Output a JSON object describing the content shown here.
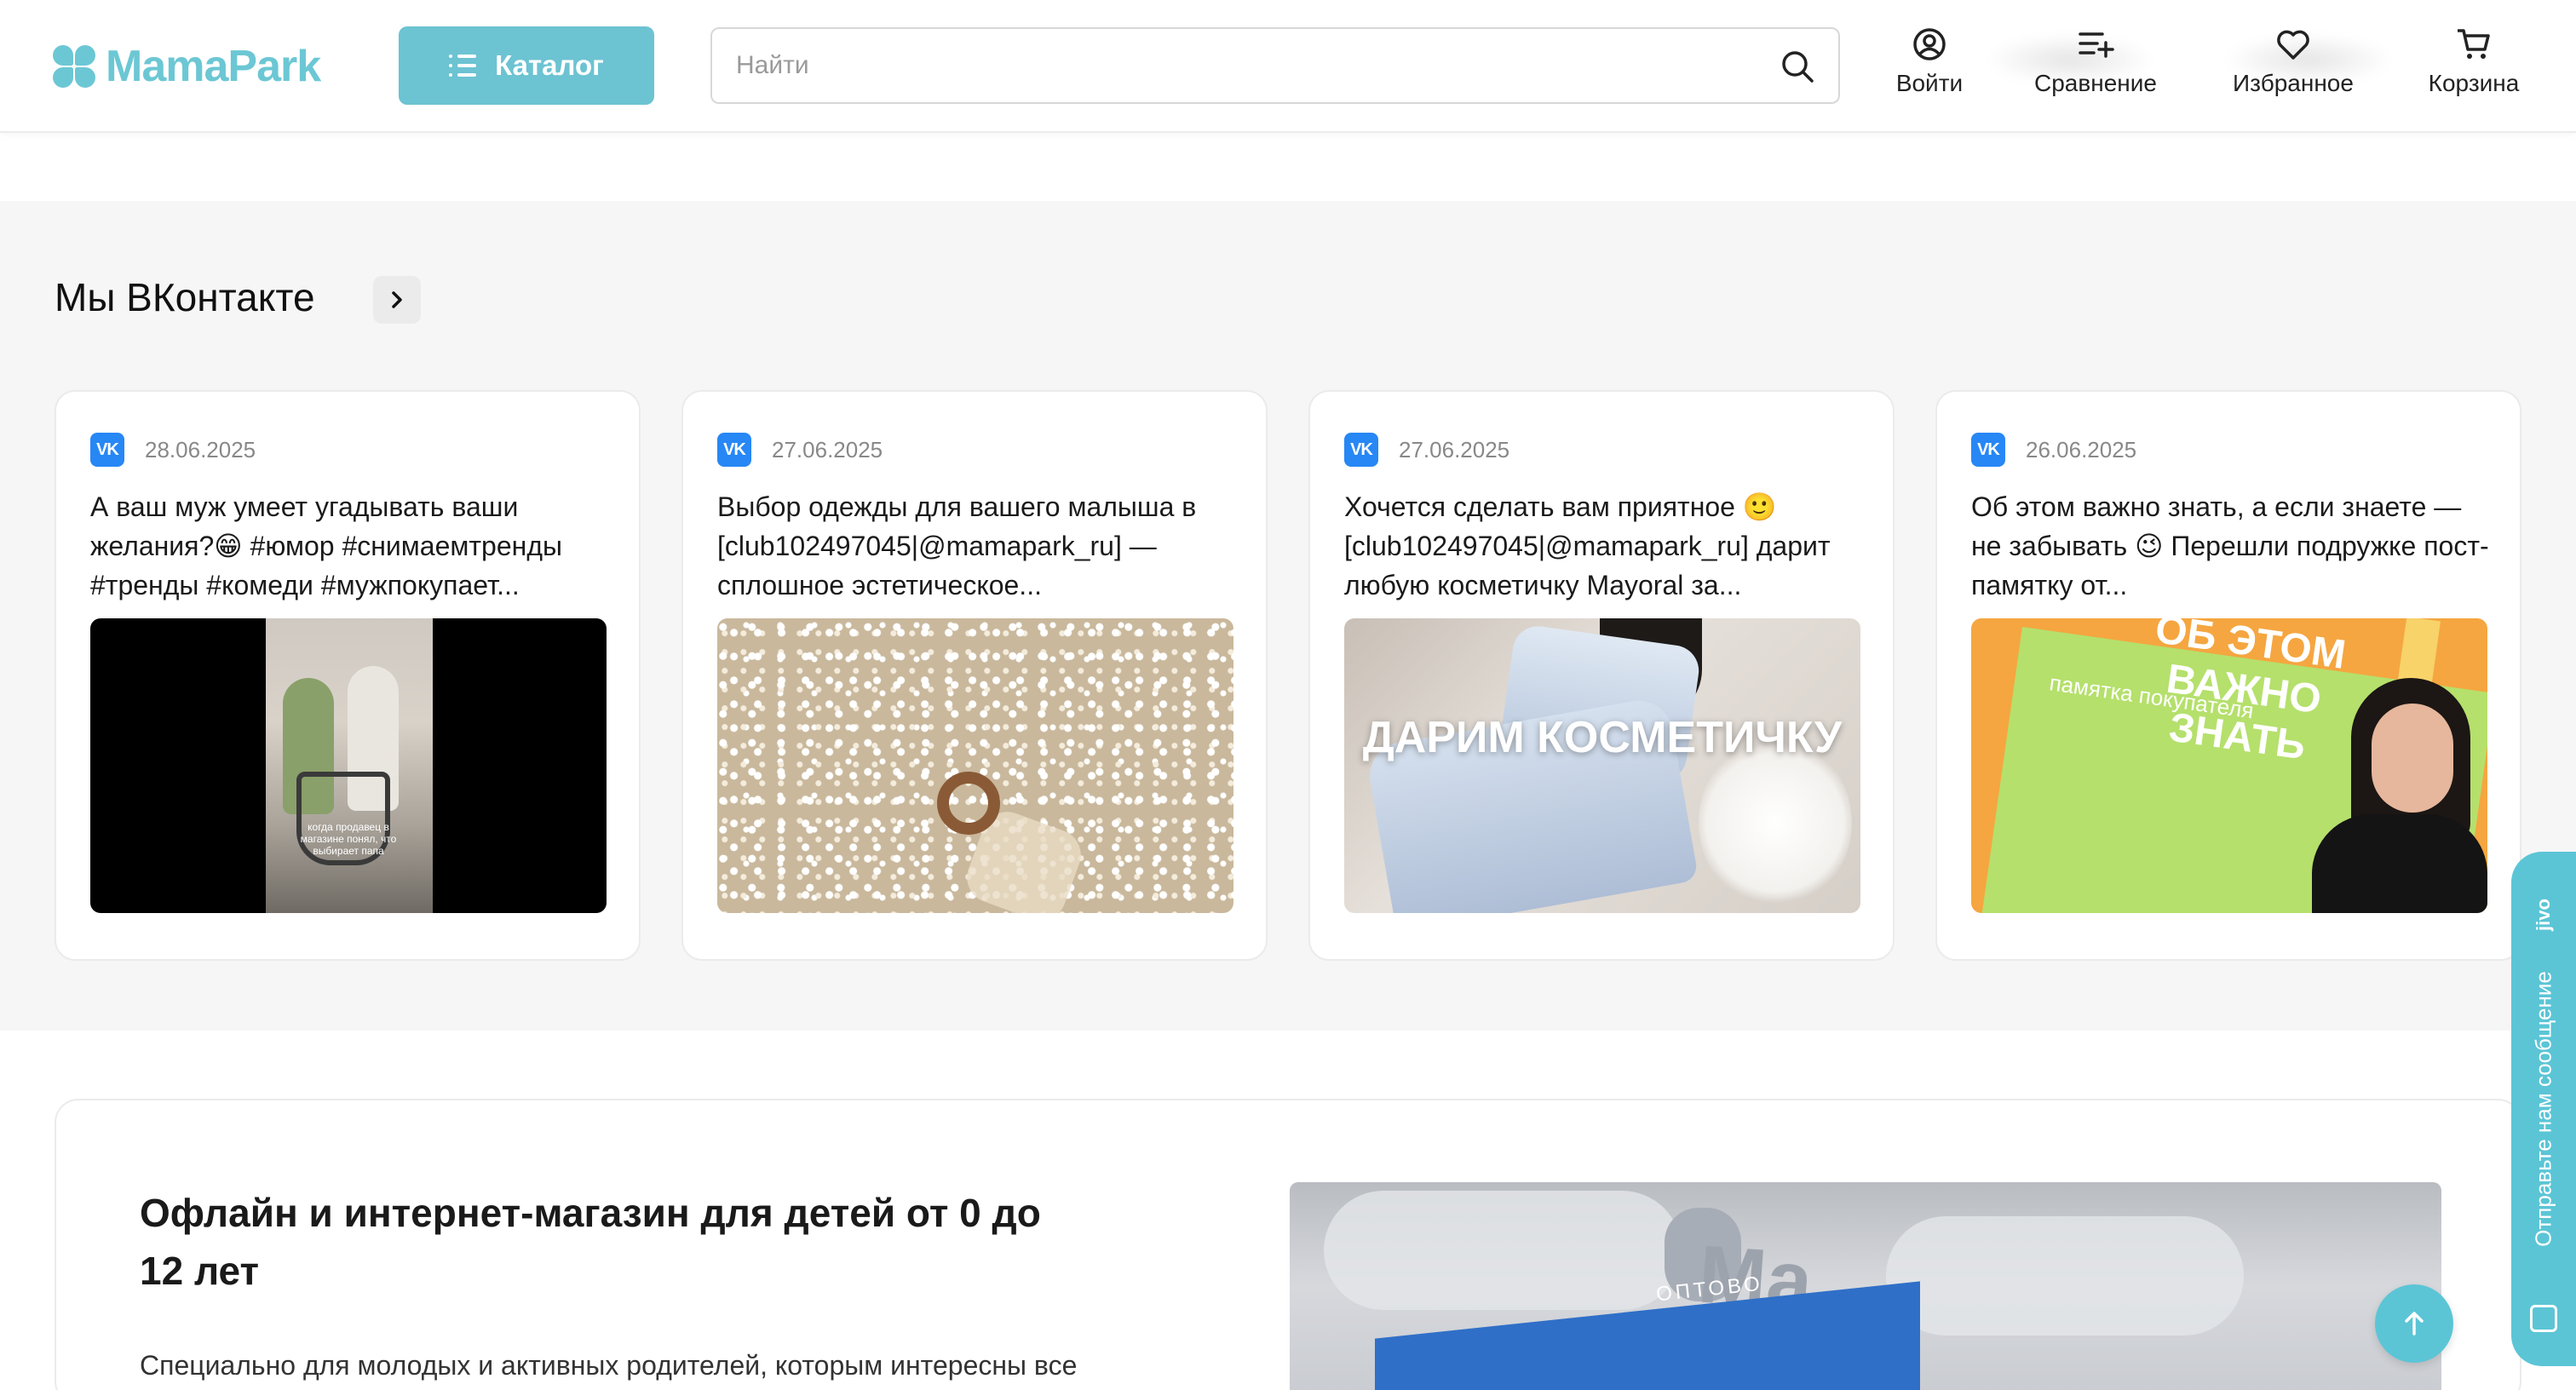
{
  "header": {
    "logo_text": "MamaPark",
    "catalog_label": "Каталог",
    "search_placeholder": "Найти",
    "nav": {
      "login": "Войти",
      "compare": "Сравнение",
      "favorites": "Избранное",
      "cart": "Корзина"
    }
  },
  "colors": {
    "accent": "#6cc3d2",
    "vk_blue": "#2787f5",
    "section_bg": "#f6f6f6"
  },
  "vk": {
    "title": "Мы ВКонтакте",
    "badge": "VK",
    "posts": [
      {
        "date": "28.06.2025",
        "text": "А ваш муж умеет угадывать ваши желания?😁 #юмор #снимаемтренды #тренды #комеди #мужпокупает...",
        "image_caption": "когда продавец в магазине понял, что выбирает папа"
      },
      {
        "date": "27.06.2025",
        "text": "Выбор одежды для вашего малыша в [club102497045|@mamapark_ru] — сплошное эстетическое..."
      },
      {
        "date": "27.06.2025",
        "text": "Хочется сделать вам приятное 🙂 [club102497045|@mamapark_ru] дарит любую косметичку Mayoral за...",
        "image_overlay": "ДАРИМ КОСМЕТИЧКУ"
      },
      {
        "date": "26.06.2025",
        "text": "Об этом важно знать, а если знаете — не забывать 😉 Перешли подружке пост-памятку от...",
        "image_title": "ОБ ЭТОМ ВАЖНО ЗНАТЬ",
        "image_subtitle": "памятка покупателя"
      }
    ]
  },
  "about": {
    "title": "Офлайн и интернет-магазин для детей от 0 до 12 лет",
    "text": "Специально для молодых и активных родителей, которым интересны все",
    "photo_sign": "ОПТОВО",
    "photo_letters": "Ma"
  },
  "widgets": {
    "jivo_text": "Отправьте нам сообщение",
    "jivo_brand": "jivo"
  }
}
